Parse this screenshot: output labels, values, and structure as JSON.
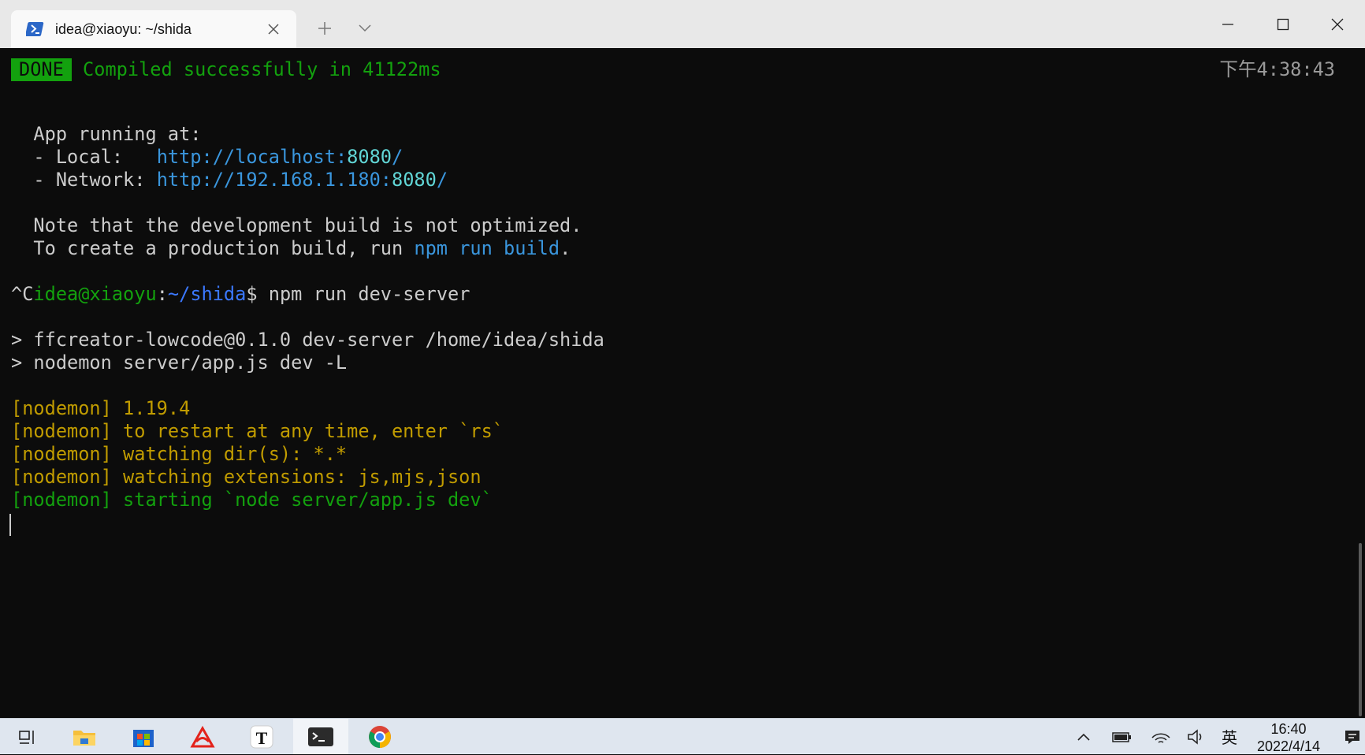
{
  "window": {
    "tab_title": "idea@xiaoyu: ~/shida",
    "tab_icon": "powershell-icon",
    "controls": [
      "minimize-icon",
      "maximize-icon",
      "close-icon"
    ]
  },
  "terminal": {
    "done_badge": "DONE",
    "compiled_msg": "Compiled successfully in 41122ms",
    "timestamp": "下午4:38:43",
    "app_running": "App running at:",
    "local_label": "- Local:   ",
    "local_url_a": "http://localhost:",
    "local_port": "8080",
    "local_url_b": "/",
    "network_label": "- Network: ",
    "network_url_a": "http://192.168.1.180:",
    "network_port": "8080",
    "network_url_b": "/",
    "note1": "Note that the development build is not optimized.",
    "note2_a": "To create a production build, run ",
    "note2_cmd": "npm run build",
    "note2_b": ".",
    "prompt_ctrl": "^C",
    "prompt_user": "idea@xiaoyu",
    "prompt_colon": ":",
    "prompt_path": "~/shida",
    "prompt_dollar": "$ ",
    "prompt_cmd": "npm run dev-server",
    "out1": "> ffcreator-lowcode@0.1.0 dev-server /home/idea/shida",
    "out2": "> nodemon server/app.js dev -L",
    "nodemon1": "[nodemon] 1.19.4",
    "nodemon2": "[nodemon] to restart at any time, enter `rs`",
    "nodemon3": "[nodemon] watching dir(s): *.*",
    "nodemon4": "[nodemon] watching extensions: js,mjs,json",
    "nodemon5": "[nodemon] starting `node server/app.js dev`"
  },
  "colors": {
    "background": "#0c0c0c",
    "green": "#13a10e",
    "yellow": "#c19c00",
    "blue": "#3b78ff",
    "link": "#3a96dd",
    "cyan": "#61d6d6"
  },
  "taskbar": {
    "apps": [
      "task-view-icon",
      "file-explorer-icon",
      "microsoft-store-icon",
      "acrobat-icon",
      "typora-icon",
      "terminal-icon",
      "chrome-icon"
    ],
    "tray": [
      "show-hidden-icons-icon",
      "battery-icon",
      "wifi-icon",
      "volume-icon"
    ],
    "ime": "英",
    "time": "16:40",
    "date": "2022/4/14"
  }
}
